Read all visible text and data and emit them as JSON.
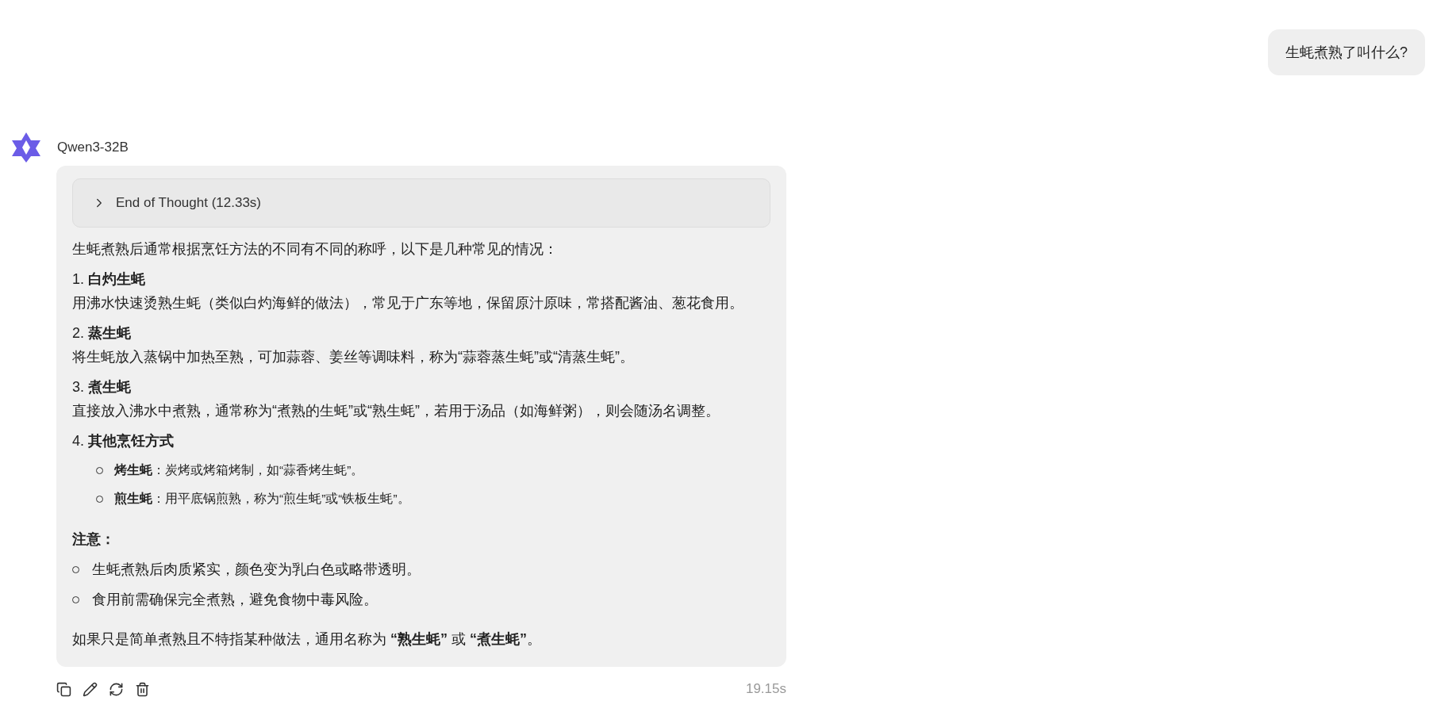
{
  "user_message": {
    "text": "生蚝煮熟了叫什么?"
  },
  "assistant": {
    "name": "Qwen3-32B",
    "thought": {
      "label": "End of Thought (12.33s)",
      "expanded": false
    },
    "intro": "生蚝煮熟后通常根据烹饪方法的不同有不同的称呼，以下是几种常见的情况：",
    "sections": [
      {
        "number": "1.",
        "title": "白灼生蚝",
        "body": "用沸水快速烫熟生蚝（类似白灼海鲜的做法），常见于广东等地，保留原汁原味，常搭配酱油、葱花食用。"
      },
      {
        "number": "2.",
        "title": "蒸生蚝",
        "body": "将生蚝放入蒸锅中加热至熟，可加蒜蓉、姜丝等调味料，称为“蒜蓉蒸生蚝”或“清蒸生蚝”。"
      },
      {
        "number": "3.",
        "title": "煮生蚝",
        "body": "直接放入沸水中煮熟，通常称为“煮熟的生蚝”或“熟生蚝”，若用于汤品（如海鲜粥），则会随汤名调整。"
      },
      {
        "number": "4.",
        "title": "其他烹饪方式",
        "items": [
          "**烤生蚝**：炭烤或烤箱烤制，如“蒜香烤生蚝”。",
          "**煎生蚝**：用平底锅煎熟，称为“煎生蚝”或“铁板生蚝”。"
        ]
      }
    ],
    "note": {
      "title": "注意：",
      "bullets": [
        "生蚝煮熟后肉质紧实，颜色变为乳白色或略带透明。",
        "食用前需确保完全煮熟，避免食物中毒风险。"
      ]
    },
    "conclusion": "如果只是简单煮熟且不特指某种做法，通用名称为 **“熟生蚝”** 或 **“煮生蚝”**。",
    "footer": {
      "time": "19.15s"
    }
  }
}
